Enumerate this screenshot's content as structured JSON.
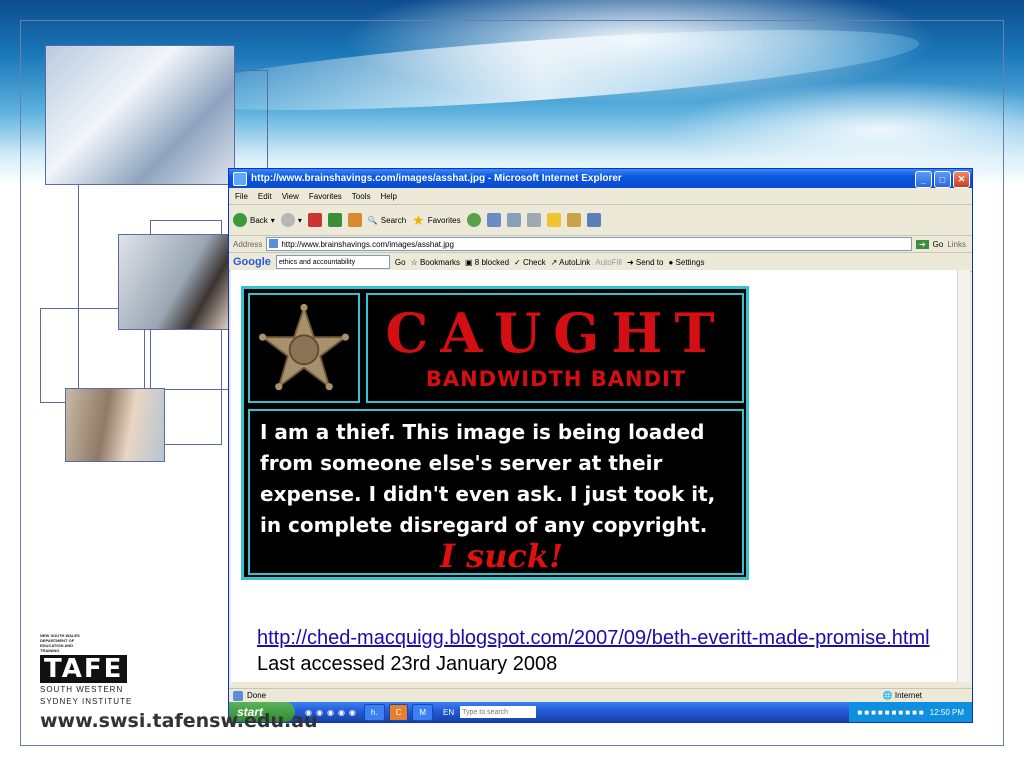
{
  "ie": {
    "title": "http://www.brainshavings.com/images/asshat.jpg - Microsoft Internet Explorer",
    "menu": [
      "File",
      "Edit",
      "View",
      "Favorites",
      "Tools",
      "Help"
    ],
    "toolbar": {
      "back": "Back",
      "search": "Search",
      "favorites": "Favorites"
    },
    "address": {
      "label": "Address",
      "url": "http://www.brainshavings.com/images/asshat.jpg",
      "go": "Go",
      "links": "Links"
    },
    "google": {
      "brand": "Google",
      "query": "ethics and accountability",
      "go": "Go",
      "bookmarks": "Bookmarks",
      "blocked": "8 blocked",
      "check": "Check",
      "autolink": "AutoLink",
      "autofill": "AutoFill",
      "sendto": "Send to",
      "settings": "Settings"
    },
    "status": {
      "text": "Done",
      "zone": "Internet"
    }
  },
  "image": {
    "caught": "CAUGHT",
    "bandit": "BANDWIDTH BANDIT",
    "message": "I am a thief. This image is being loaded from someone else's server at their expense. I didn't even ask. I just took it, in complete disregard of any copyright.",
    "suck": "I suck!"
  },
  "taskbar": {
    "start": "start",
    "tasks": [
      "h.",
      "C",
      "M"
    ],
    "lang": "EN",
    "search_placeholder": "Type to search",
    "time": "12:50 PM"
  },
  "slide": {
    "link": "http://ched-macquigg.blogspot.com/2007/09/beth-everitt-made-promise.html",
    "note": "Last accessed 23rd January 2008"
  },
  "logo": {
    "small_text": "NEW SOUTH WALES DEPARTMENT OF EDUCATION AND TRAINING",
    "tafe": "TAFE",
    "institute_1": "SOUTH WESTERN",
    "institute_2": "SYDNEY INSTITUTE",
    "website": "www.swsi.tafensw.edu.au"
  },
  "colors": {
    "frame": "#38c2cf",
    "caught_red": "#d40f14",
    "xp_blue": "#0b56e0",
    "link": "#1a0dab"
  }
}
